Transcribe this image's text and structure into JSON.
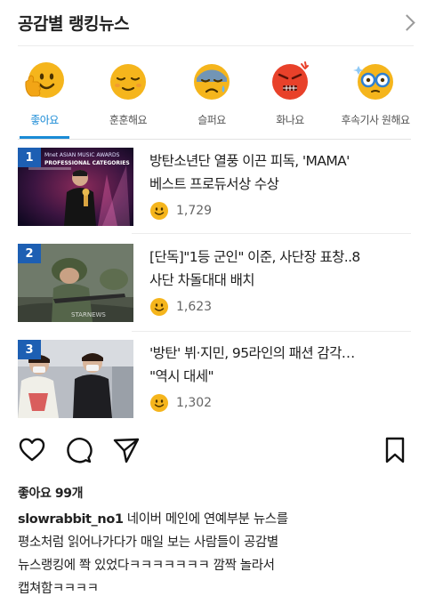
{
  "header": {
    "title": "공감별 랭킹뉴스",
    "more_icon": "chevron-right-icon"
  },
  "reactions": [
    {
      "label": "좋아요",
      "icon": "like-face-icon",
      "active": true
    },
    {
      "label": "훈훈해요",
      "icon": "warm-face-icon",
      "active": false
    },
    {
      "label": "슬퍼요",
      "icon": "sad-face-icon",
      "active": false
    },
    {
      "label": "화나요",
      "icon": "angry-face-icon",
      "active": false
    },
    {
      "label": "후속기사 원해요",
      "icon": "want-more-face-icon",
      "active": false
    }
  ],
  "news": [
    {
      "rank": "1",
      "line1": "방탄소년단 열풍 이끈 피독, 'MAMA'",
      "line2": "베스트 프로듀서상 수상",
      "count": "1,729",
      "thumb_caption_1": "Mnet ASIAN MUSIC AWARDS",
      "thumb_caption_2": "PROFESSIONAL CATEGORIES"
    },
    {
      "rank": "2",
      "line1": "[단독]\"1등 군인\" 이준, 사단장 표창..8",
      "line2": "사단 차돌대대 배치",
      "count": "1,623",
      "thumb_watermark": "STARNEWS"
    },
    {
      "rank": "3",
      "line1": "'방탄' 뷔·지민, 95라인의 패션 감각…",
      "line2": "\"역시 대세\"",
      "count": "1,302"
    }
  ],
  "post": {
    "likes": "좋아요 99개",
    "username": "slowrabbit_no1",
    "caption_line1": " 네이버 메인에 연예부분 뉴스를",
    "caption_line2": "평소처럼 읽어나가다가 매일 보는 사람들이 공감별",
    "caption_line3": "뉴스랭킹에 쫙 있었다ㅋㅋㅋㅋㅋㅋㅋ 깜짝 놀라서",
    "caption_line4": "캡쳐함ㅋㅋㅋㅋ"
  },
  "colors": {
    "accent": "#1a8bd6",
    "rank_badge": "#1d5fb3",
    "emoji_yellow": "#f5b51c",
    "angry_red": "#e8412a"
  }
}
